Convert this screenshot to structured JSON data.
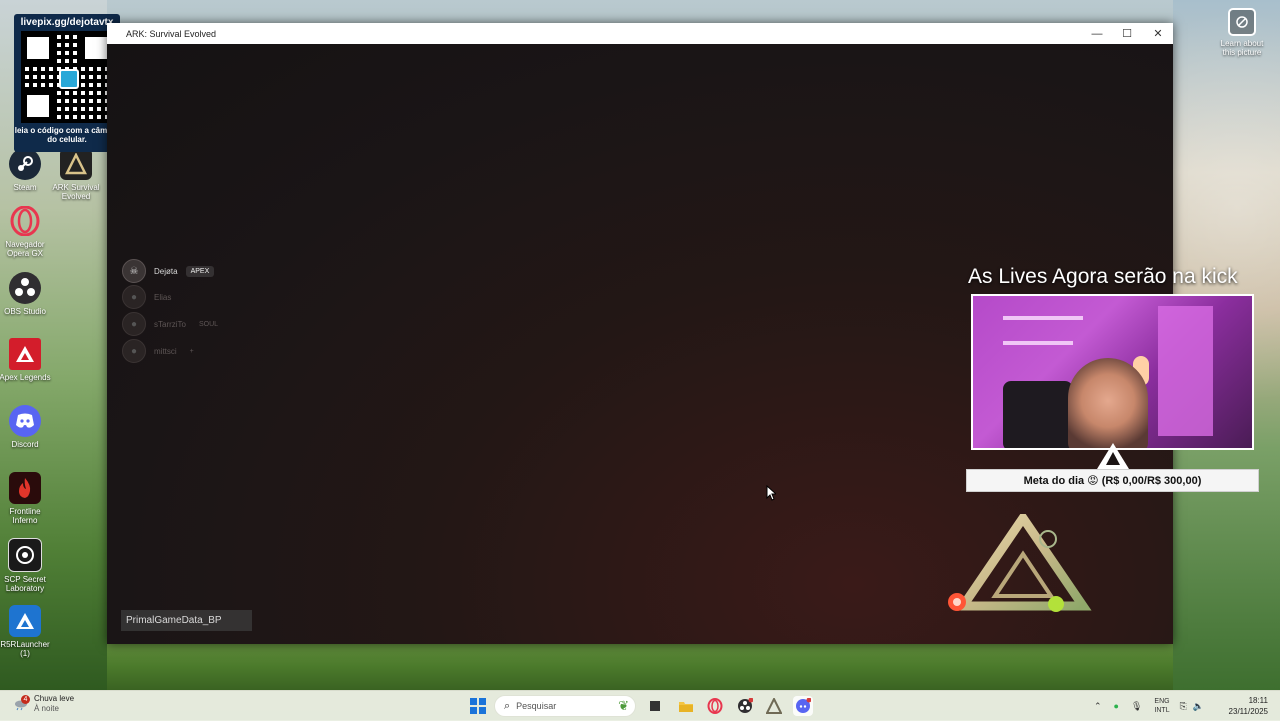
{
  "desktop": {
    "qr_overlay": {
      "url": "livepix.gg/dejotavtx",
      "hint": "leia o código com a câmera do celular."
    },
    "learn_label": "Learn about this picture",
    "icons": [
      {
        "label": "Steam",
        "icon": "steam-icon"
      },
      {
        "label": "ARK Survival Evolved",
        "icon": "ark-icon"
      },
      {
        "label": "Navegador Opera GX",
        "icon": "opera-gx-icon"
      },
      {
        "label": "OBS Studio",
        "icon": "obs-icon"
      },
      {
        "label": "Apex Legends",
        "icon": "apex-icon"
      },
      {
        "label": "Discord",
        "icon": "discord-icon"
      },
      {
        "label": "Frontline Inferno",
        "icon": "frontline-icon"
      },
      {
        "label": "SCP Secret Laboratory",
        "icon": "scp-icon"
      },
      {
        "label": "R5RLauncher (1)",
        "icon": "r5r-icon"
      }
    ]
  },
  "window": {
    "title": "ARK: Survival Evolved",
    "controls": {
      "minimize": "—",
      "maximize": "☐",
      "close": "✕"
    }
  },
  "game": {
    "party": [
      {
        "name": "Dejøta",
        "tag": "APEX",
        "active": true
      },
      {
        "name": "Elias",
        "tag": "",
        "active": false
      },
      {
        "name": "sTarrziTo",
        "tag": "SOUL",
        "active": false
      },
      {
        "name": "mittsci",
        "tag": "+",
        "active": false
      }
    ],
    "loading_label": "PrimalGameData_BP"
  },
  "stream": {
    "title": "As Lives Agora serão na kick",
    "goal": "Meta do dia 😡 (R$ 0,00/R$ 300,00)"
  },
  "taskbar": {
    "weather": {
      "badge": "4",
      "condition": "Chuva leve",
      "time_of_day": "À noite"
    },
    "search_placeholder": "Pesquisar",
    "apps": [
      "file-explorer-icon",
      "task-view-icon",
      "opera-gx-icon",
      "obs-icon",
      "ark-icon",
      "discord-icon"
    ],
    "tray": {
      "lang": "ENG",
      "layout": "INTL"
    },
    "clock": {
      "time": "18:11",
      "date": "23/11/2025"
    }
  },
  "colors": {
    "window_bg": "#1a1414",
    "accent_blue": "#1a73d9",
    "goal_bg": "#f5f5f5"
  }
}
